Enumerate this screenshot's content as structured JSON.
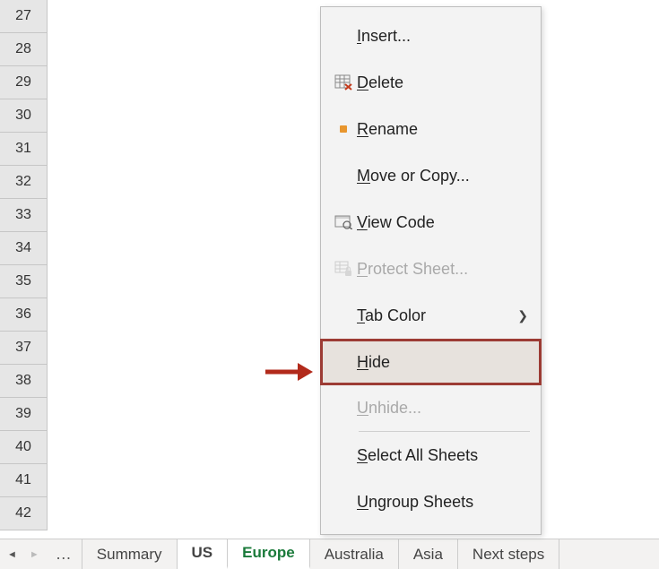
{
  "rows": [
    "27",
    "28",
    "29",
    "30",
    "31",
    "32",
    "33",
    "34",
    "35",
    "36",
    "37",
    "38",
    "39",
    "40",
    "41",
    "42"
  ],
  "tabs": {
    "ellipsis": "…",
    "items": [
      {
        "label": "Summary",
        "selected": false
      },
      {
        "label": "US",
        "selected": true
      },
      {
        "label": "Europe",
        "selected": true,
        "green": true
      },
      {
        "label": "Australia",
        "selected": false
      },
      {
        "label": "Asia",
        "selected": false
      },
      {
        "label": "Next steps",
        "selected": false
      }
    ]
  },
  "menu": {
    "insert": "Insert...",
    "delete": "Delete",
    "rename": "Rename",
    "move": "Move or Copy...",
    "viewcode": "View Code",
    "protect": "Protect Sheet...",
    "tabcolor": "Tab Color",
    "hide": "Hide",
    "unhide": "Unhide...",
    "selectall": "Select All Sheets",
    "ungroup": "Ungroup Sheets"
  }
}
